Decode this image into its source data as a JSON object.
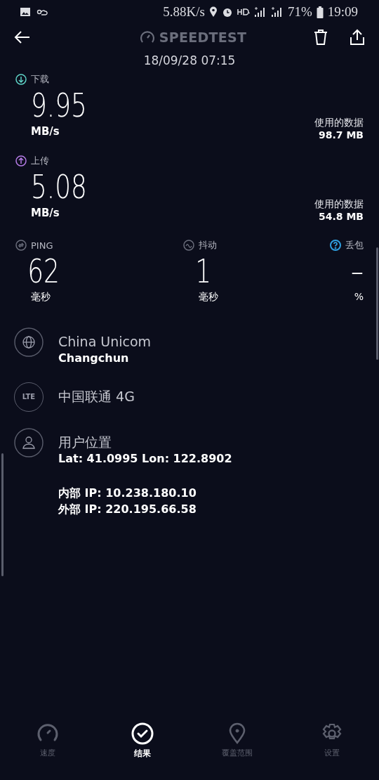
{
  "status_bar": {
    "network_speed": "5.88K/s",
    "battery": "71%",
    "time": "19:09"
  },
  "header": {
    "title": "SPEEDTEST",
    "date": "18/09/28 07:15"
  },
  "results": [
    {
      "kind": "download",
      "label": "下载",
      "color": "#5fd3c7",
      "value": "9.95",
      "unit": "MB/s",
      "data_label": "使用的数据",
      "data_value": "98.7 MB"
    },
    {
      "kind": "upload",
      "label": "上传",
      "color": "#b57be6",
      "value": "5.08",
      "unit": "MB/s",
      "data_label": "使用的数据",
      "data_value": "54.8 MB"
    }
  ],
  "metrics": [
    {
      "kind": "ping",
      "label": "PING",
      "color": "#6b6e7c",
      "value": "62",
      "unit": "毫秒"
    },
    {
      "kind": "jitter",
      "label": "抖动",
      "color": "#6b6e7c",
      "value": "1",
      "unit": "毫秒"
    },
    {
      "kind": "loss",
      "label": "丢包",
      "color": "#2f9fe0",
      "value": "–",
      "unit": "%"
    }
  ],
  "info": [
    {
      "kind": "provider",
      "title": "China Unicom",
      "lines": [
        "Changchun"
      ]
    },
    {
      "kind": "network",
      "badge": "LTE",
      "title": "中国联通 4G"
    },
    {
      "kind": "location",
      "title": "用户位置",
      "lines": [
        "Lat: 41.0995 Lon: 122.8902"
      ],
      "extra": [
        "内部 IP: 10.238.180.10",
        "外部 IP: 220.195.66.58"
      ]
    }
  ],
  "nav": [
    {
      "kind": "speed",
      "label": "速度",
      "selected": false
    },
    {
      "kind": "results",
      "label": "结果",
      "selected": true
    },
    {
      "kind": "coverage",
      "label": "覆盖范围",
      "selected": false
    },
    {
      "kind": "settings",
      "label": "设置",
      "selected": false
    }
  ]
}
